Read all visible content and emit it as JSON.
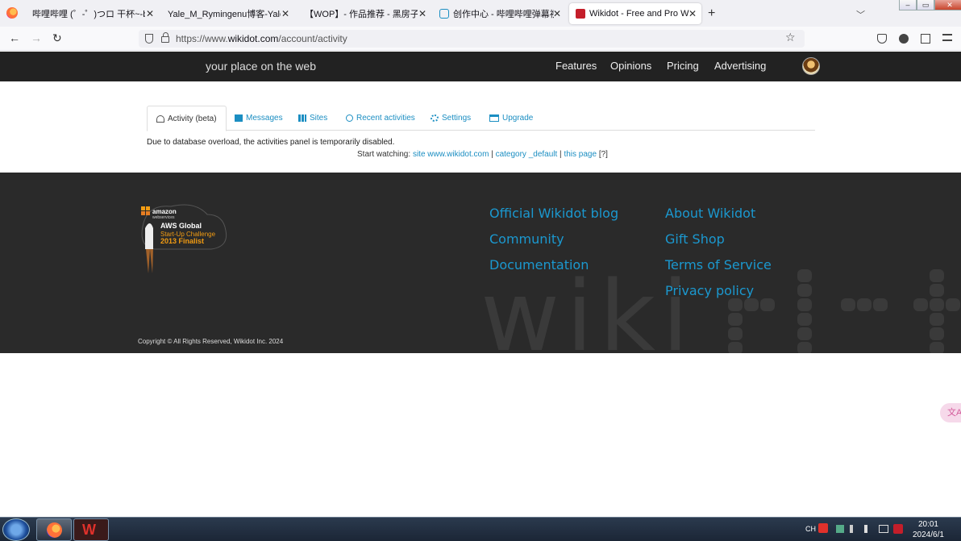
{
  "browser": {
    "tabs": [
      {
        "title": "哔哩哔哩 (゜-゜)つロ 干杯~-bilibili",
        "active": false
      },
      {
        "title": "Yale_M_Rymingenu博客-Yale_M_Ry",
        "active": false
      },
      {
        "title": "【WOP】- 作品推荐 - 黑房子 - 哔哩",
        "active": false
      },
      {
        "title": "创作中心 - 哔哩哔哩弹幕视频网",
        "active": false
      },
      {
        "title": "Wikidot - Free and Pro Wiki Hosting",
        "active": true
      }
    ],
    "url_prefix": "https://www.",
    "url_domain": "wikidot.com",
    "url_path": "/account/activity",
    "new_tab": "+",
    "close_glyph": "✕",
    "back": "←",
    "forward": "→",
    "reload": "↻",
    "star": "☆"
  },
  "site": {
    "tagline": "your place on the web",
    "nav": [
      "Features",
      "Opinions",
      "Pricing",
      "Advertising"
    ]
  },
  "account": {
    "tabs": [
      {
        "label": "Activity (beta)",
        "icon": "dashboard-icon",
        "active": true
      },
      {
        "label": "Messages",
        "icon": "envelope-icon",
        "active": false
      },
      {
        "label": "Sites",
        "icon": "grid-icon",
        "active": false
      },
      {
        "label": "Recent activities",
        "icon": "clock-icon",
        "active": false
      },
      {
        "label": "Settings",
        "icon": "gears-icon",
        "active": false
      },
      {
        "label": "Upgrade",
        "icon": "credit-card-icon",
        "active": false
      }
    ],
    "notice": "Due to database overload, the activities panel is temporarily disabled.",
    "watch_label": "Start watching:",
    "watch_site": "site www.wikidot.com",
    "watch_sep1": " | ",
    "watch_category": "category _default",
    "watch_sep2": " | ",
    "watch_page": "this page",
    "watch_help": "[?]"
  },
  "footer": {
    "aws_line1": "amazon",
    "aws_line2": "webservices",
    "aws_line3": "AWS Global",
    "aws_line4": "Start-Up Challenge",
    "aws_line5": "2013 Finalist",
    "col1": [
      "Official Wikidot blog",
      "Community",
      "Documentation"
    ],
    "col2": [
      "About Wikidot",
      "Gift Shop",
      "Terms of Service",
      "Privacy policy"
    ],
    "copyright": "Copyright © All Rights Reserved, Wikidot Inc. 2024",
    "watermark": "wiki"
  },
  "taskbar": {
    "lang": "CH",
    "time": "20:01",
    "date": "2024/6/1"
  },
  "translate_label": "文A"
}
